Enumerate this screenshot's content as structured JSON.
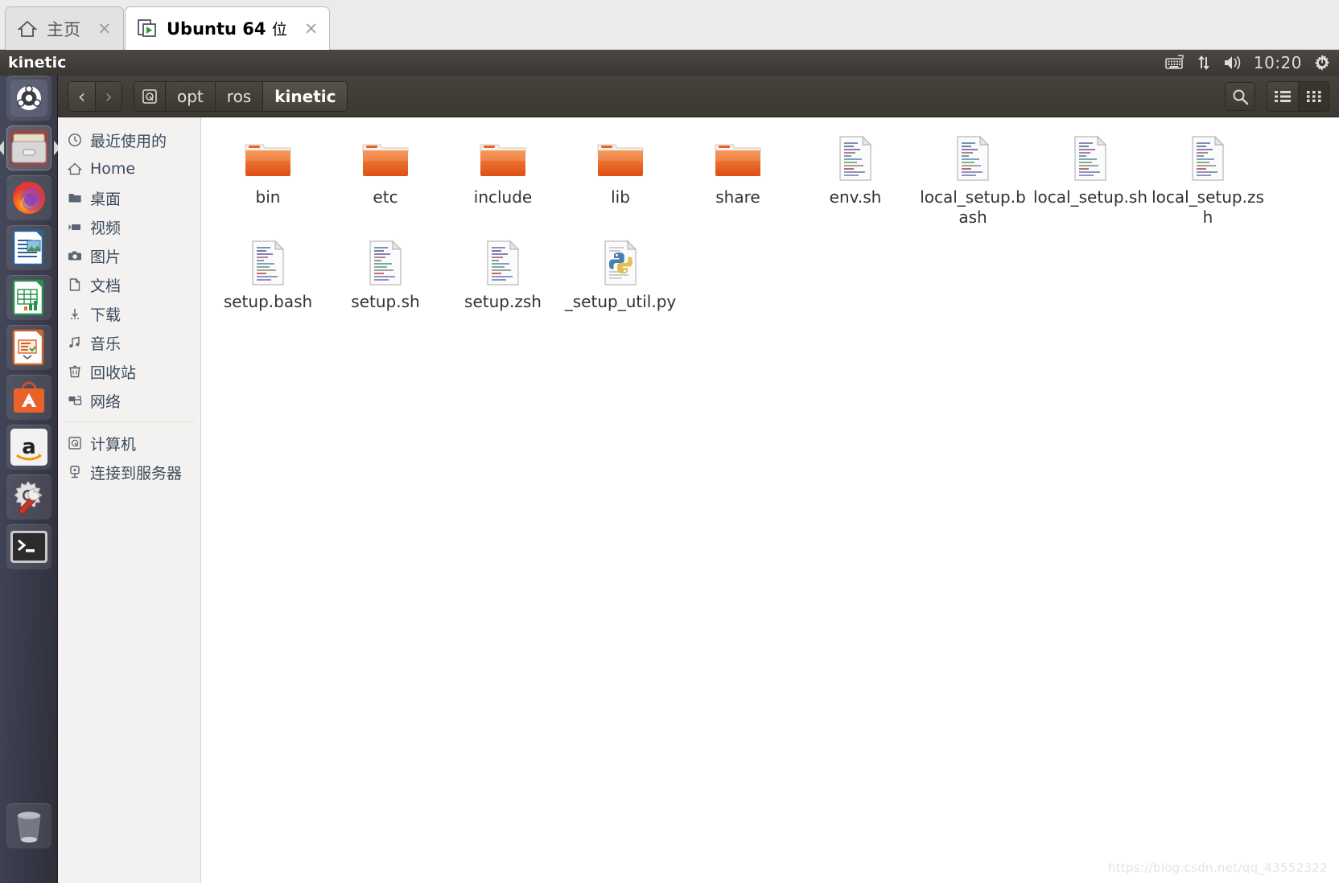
{
  "vmware": {
    "tabs": [
      {
        "label": "主页",
        "icon": "home-icon",
        "active": false,
        "close": "×"
      },
      {
        "label": "Ubuntu 64 ",
        "label_suffix": "位",
        "icon": "vm-play-icon",
        "active": true,
        "close": "×"
      }
    ]
  },
  "top_panel": {
    "title": "kinetic",
    "clock": "10:20",
    "indicators": [
      "keyboard-icon",
      "network-icon",
      "volume-icon",
      "power-gear-icon"
    ]
  },
  "launcher": {
    "items": [
      {
        "name": "ubuntu-dash",
        "label": "Dash"
      },
      {
        "name": "files",
        "label": "Files",
        "selected": true
      },
      {
        "name": "firefox",
        "label": "Firefox"
      },
      {
        "name": "libreoffice-writer",
        "label": "LibreOffice Writer"
      },
      {
        "name": "libreoffice-calc",
        "label": "LibreOffice Calc"
      },
      {
        "name": "libreoffice-impress",
        "label": "LibreOffice Impress"
      },
      {
        "name": "ubuntu-software",
        "label": "Ubuntu Software"
      },
      {
        "name": "amazon",
        "label": "Amazon"
      },
      {
        "name": "system-settings",
        "label": "System Settings"
      },
      {
        "name": "terminal",
        "label": "Terminal"
      },
      {
        "name": "trash",
        "label": "Trash"
      }
    ]
  },
  "toolbar": {
    "back_label": "‹",
    "forward_label": "›",
    "breadcrumbs": [
      {
        "label": "",
        "icon": "device-icon",
        "current": false
      },
      {
        "label": "opt",
        "current": false
      },
      {
        "label": "ros",
        "current": false
      },
      {
        "label": "kinetic",
        "current": true
      }
    ],
    "search_label": "search-icon",
    "list_view_label": "list-view-icon",
    "grid_view_label": "grid-view-icon",
    "active_view": "grid"
  },
  "sidebar": {
    "items": [
      {
        "label": "最近使用的",
        "icon": "clock-icon"
      },
      {
        "label": "Home",
        "icon": "home-icon"
      },
      {
        "label": "桌面",
        "icon": "folder-icon"
      },
      {
        "label": "视频",
        "icon": "video-icon"
      },
      {
        "label": "图片",
        "icon": "camera-icon"
      },
      {
        "label": "文档",
        "icon": "document-icon"
      },
      {
        "label": "下载",
        "icon": "download-icon"
      },
      {
        "label": "音乐",
        "icon": "music-icon"
      },
      {
        "label": "回收站",
        "icon": "trash-icon"
      },
      {
        "label": "网络",
        "icon": "network-icon"
      }
    ],
    "items2": [
      {
        "label": "计算机",
        "icon": "computer-icon"
      },
      {
        "label": "连接到服务器",
        "icon": "connect-server-icon"
      }
    ]
  },
  "files": [
    {
      "name": "bin",
      "type": "folder"
    },
    {
      "name": "etc",
      "type": "folder"
    },
    {
      "name": "include",
      "type": "folder"
    },
    {
      "name": "lib",
      "type": "folder"
    },
    {
      "name": "share",
      "type": "folder"
    },
    {
      "name": "env.sh",
      "type": "script"
    },
    {
      "name": "local_setup.bash",
      "type": "script"
    },
    {
      "name": "local_setup.sh",
      "type": "script"
    },
    {
      "name": "local_setup.zsh",
      "type": "script"
    },
    {
      "name": "setup.bash",
      "type": "script"
    },
    {
      "name": "setup.sh",
      "type": "script"
    },
    {
      "name": "setup.zsh",
      "type": "script"
    },
    {
      "name": "_setup_util.py",
      "type": "python"
    }
  ],
  "watermark": "https://blog.csdn.net/qq_43552322",
  "colors": {
    "folder_orange": "#e8622a",
    "panel_dark": "#3b3832",
    "sidebar_bg": "#f3f2f1",
    "text": "#2e3436"
  }
}
